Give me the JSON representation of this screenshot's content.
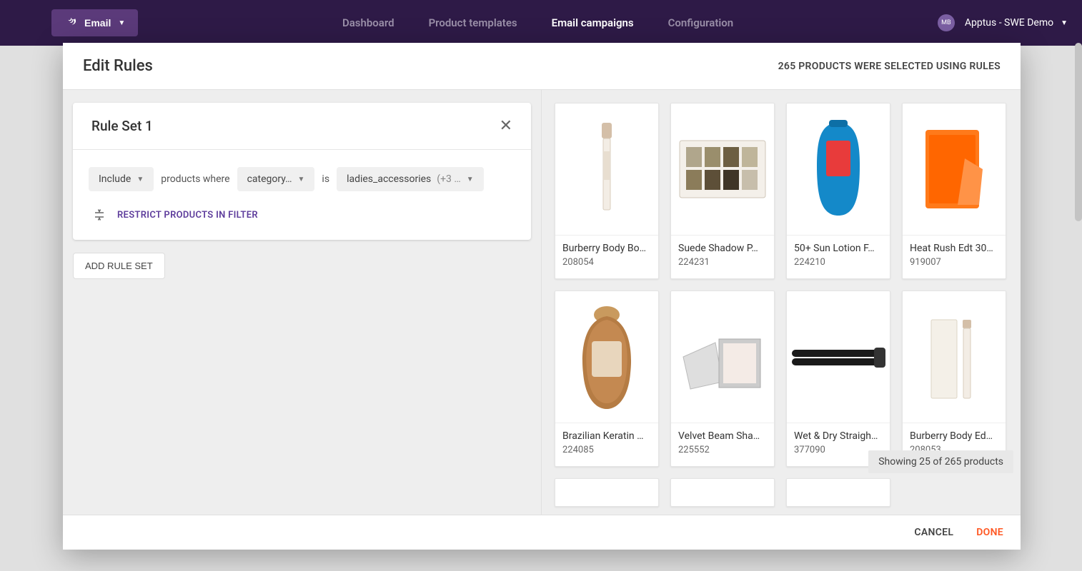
{
  "nav": {
    "email_label": "Email",
    "dashboard": "Dashboard",
    "product_templates": "Product templates",
    "email_campaigns": "Email campaigns",
    "configuration": "Configuration",
    "user_initials": "MB",
    "user_name": "Apptus - SWE Demo"
  },
  "modal": {
    "title": "Edit Rules",
    "selected_text": "265 PRODUCTS WERE SELECTED USING RULES",
    "rule_set": {
      "title": "Rule Set 1",
      "include_label": "Include",
      "products_where": "products where",
      "category_label": "category…",
      "is_label": "is",
      "value_label": "ladies_accessories",
      "value_extra": "(+3 …",
      "restrict_label": "RESTRICT PRODUCTS IN FILTER"
    },
    "add_rule_set": "ADD RULE SET",
    "showing_text": "Showing 25 of 265 products",
    "cancel": "CANCEL",
    "done": "DONE"
  },
  "products": [
    {
      "name": "Burberry Body Bo…",
      "id": "208054"
    },
    {
      "name": "Suede Shadow P…",
      "id": "224231"
    },
    {
      "name": "50+ Sun Lotion F…",
      "id": "224210"
    },
    {
      "name": "Heat Rush Edt 30…",
      "id": "919007"
    },
    {
      "name": "Brazilian Keratin …",
      "id": "224085"
    },
    {
      "name": "Velvet Beam Sha…",
      "id": "225552"
    },
    {
      "name": "Wet & Dry Straigh…",
      "id": "377090"
    },
    {
      "name": "Burberry Body Ed…",
      "id": "208053"
    }
  ]
}
